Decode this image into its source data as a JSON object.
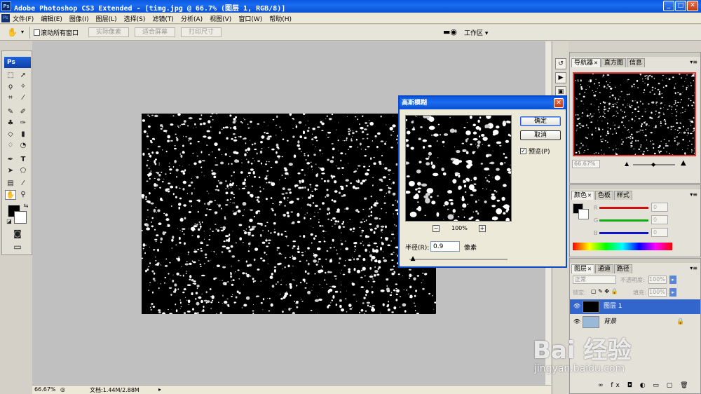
{
  "window": {
    "title": "Adobe Photoshop CS3 Extended - [timg.jpg @ 66.7% (图层 1, RGB/8)]",
    "app_icon": "Ps",
    "controls": {
      "minimize": "_",
      "maximize": "□",
      "close": "✕"
    }
  },
  "menu": [
    "文件(F)",
    "编辑(E)",
    "图像(I)",
    "图层(L)",
    "选择(S)",
    "滤镜(T)",
    "分析(A)",
    "视图(V)",
    "窗口(W)",
    "帮助(H)"
  ],
  "options_bar": {
    "scroll_all_label": "滚动所有窗口",
    "actual_pixels": "实际像素",
    "fit_screen": "适合屏幕",
    "print_size": "打印尺寸",
    "workspace": "工作区 ▾"
  },
  "toolbox": {
    "logo": "Ps"
  },
  "status_bar": {
    "zoom": "66.67%",
    "doc_info": "文档:1.44M/2.88M"
  },
  "navigator_panel": {
    "tabs": [
      "导航器",
      "直方图",
      "信息"
    ],
    "zoom": "66.67%"
  },
  "color_panel": {
    "tabs": [
      "颜色",
      "色板",
      "样式"
    ],
    "channels": [
      {
        "label": "R",
        "value": "0",
        "color": "#cc1111"
      },
      {
        "label": "G",
        "value": "0",
        "color": "#11aa11"
      },
      {
        "label": "B",
        "value": "0",
        "color": "#1111cc"
      }
    ]
  },
  "layers_panel": {
    "tabs": [
      "图层",
      "通道",
      "路径"
    ],
    "blend_mode": "正常",
    "opacity_label": "不透明度:",
    "opacity": "100%",
    "lock_label": "锁定:",
    "fill_label": "填充:",
    "fill": "100%",
    "layers": [
      {
        "name": "图层 1",
        "selected": true
      },
      {
        "name": "背景",
        "selected": false
      }
    ],
    "footer_icons": "∞ fx ◘ ◐ ▭ ▢ 🗑"
  },
  "dialog": {
    "title": "高斯模糊",
    "ok": "确定",
    "cancel": "取消",
    "preview_label": "预览(P)",
    "zoom": "100%",
    "radius_label": "半径(R):",
    "radius_value": "0.9",
    "unit": "像素",
    "radius_slider_fraction": 0.04
  },
  "watermark": {
    "brand": "Bai 经验",
    "url": "jingyan.baidu.com"
  }
}
